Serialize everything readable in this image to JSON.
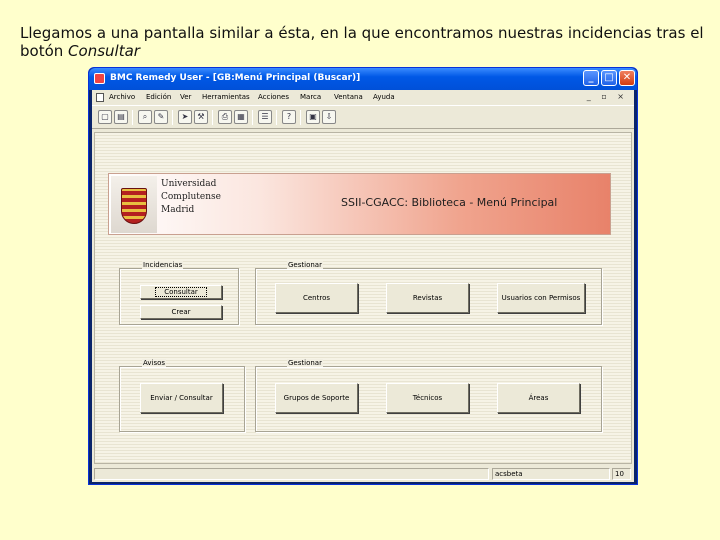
{
  "caption": {
    "text": "Llegamos a una pantalla similar a ésta, en la que encontramos nuestras incidencias tras el botón ",
    "emphasis": "Consultar"
  },
  "window": {
    "title": "BMC Remedy User - [GB:Menú Principal (Buscar)]",
    "controls": {
      "minimize": "_",
      "maximize": "□",
      "close": "✕"
    }
  },
  "menu": [
    "Archivo",
    "Edición",
    "Ver",
    "Herramientas",
    "Acciones",
    "Marca",
    "Ventana",
    "Ayuda"
  ],
  "mdi_controls": "_ ▫ ×",
  "toolbar_icons": [
    "new-icon",
    "open-icon",
    "search-icon",
    "modify-icon",
    "send-icon",
    "print-icon",
    "report-icon",
    "help-icon"
  ],
  "banner": {
    "university_lines": [
      "Universidad",
      "Complutense",
      "Madrid"
    ],
    "title": "SSII-CGACC: Biblioteca - Menú Principal"
  },
  "incidencias": {
    "label": "Incidencias",
    "consultar": "Consultar",
    "crear": "Crear"
  },
  "gestionar1": {
    "label": "Gestionar",
    "centros": "Centros",
    "revistas": "Revistas",
    "usuarios": "Usuarios con Permisos"
  },
  "avisos": {
    "label": "Avisos",
    "enviar": "Enviar / Consultar"
  },
  "gestionar2": {
    "label": "Gestionar",
    "grupos": "Grupos de Soporte",
    "tecnicos": "Técnicos",
    "areas": "Áreas"
  },
  "status": {
    "server": "acsbeta",
    "page": "10"
  }
}
